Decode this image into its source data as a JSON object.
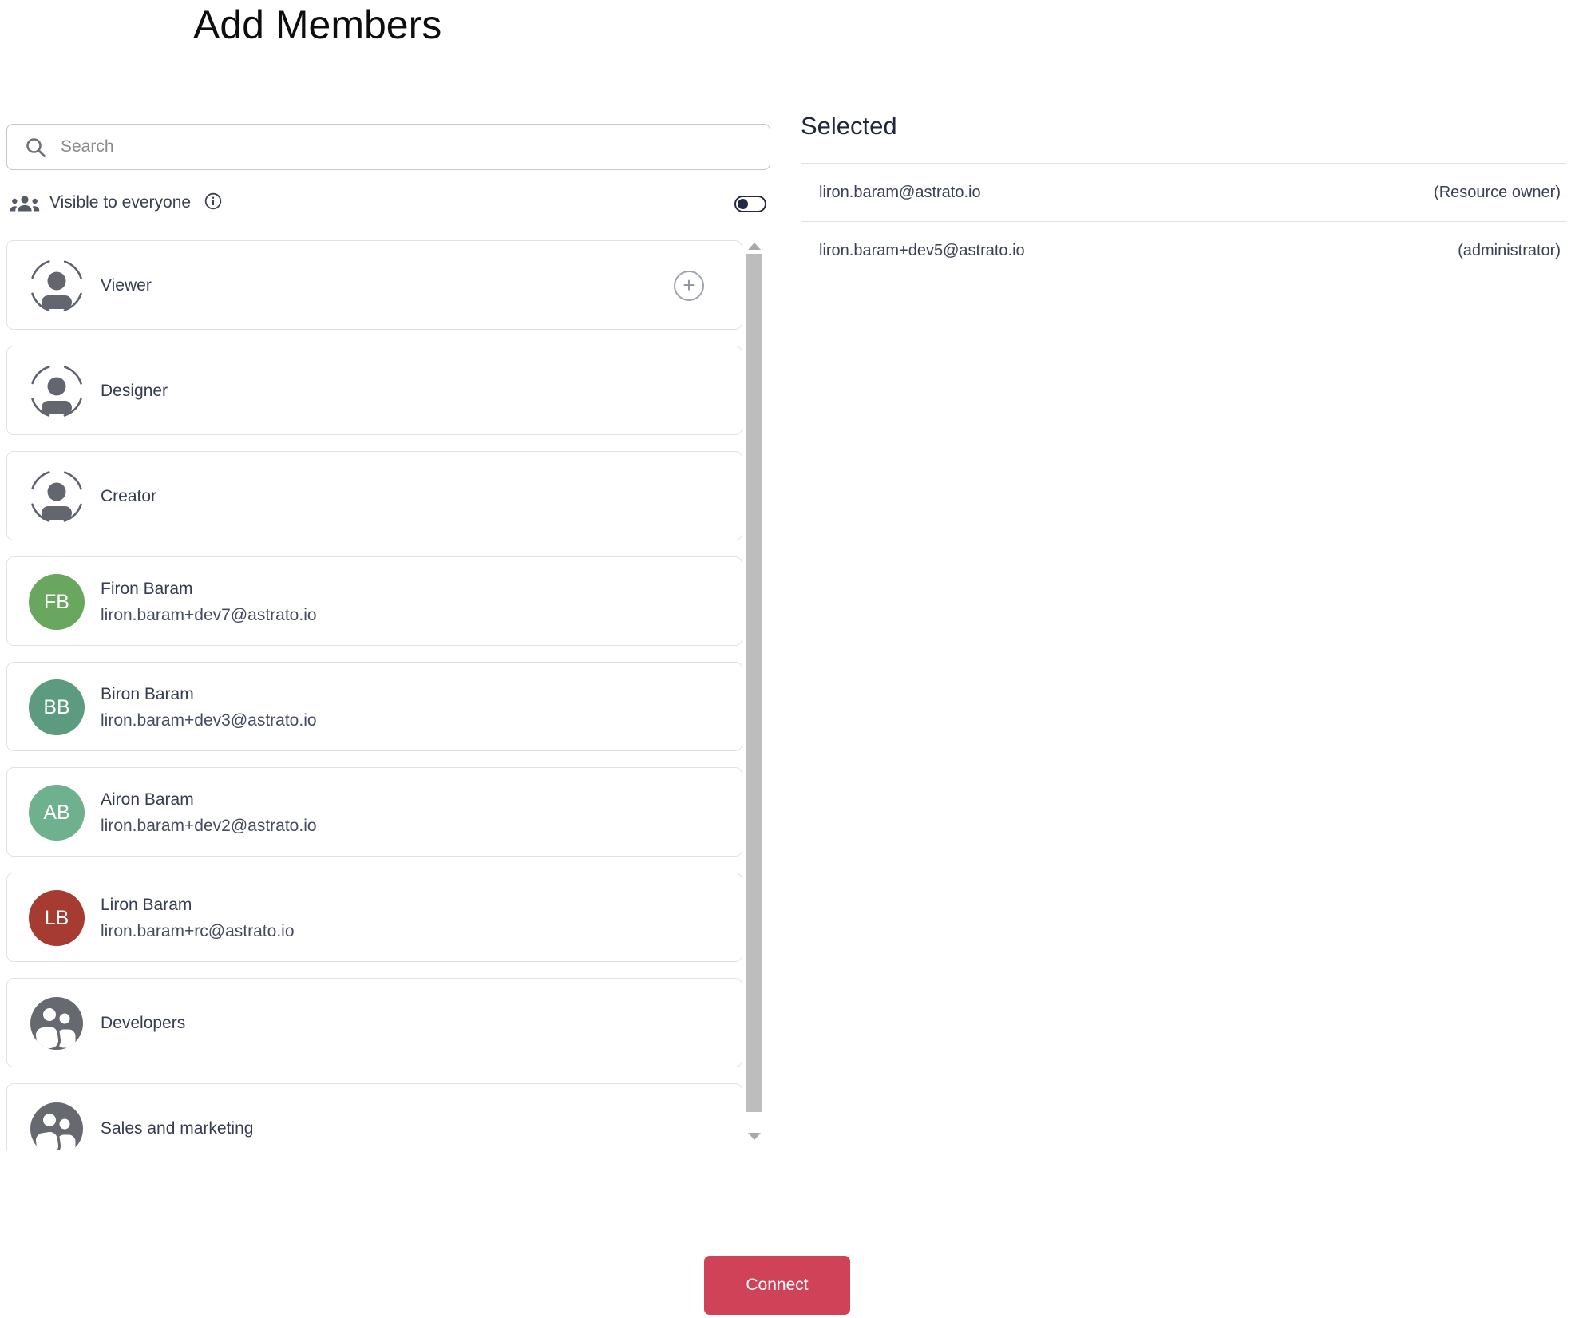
{
  "title": "Add Members",
  "search": {
    "placeholder": "Search"
  },
  "visibility": {
    "label": "Visible to everyone",
    "enabled": false
  },
  "member_list": {
    "items": [
      {
        "type": "role",
        "name": "Viewer",
        "show_add_button": true
      },
      {
        "type": "role",
        "name": "Designer",
        "show_add_button": false
      },
      {
        "type": "role",
        "name": "Creator",
        "show_add_button": false
      },
      {
        "type": "user",
        "initials": "FB",
        "name": "Firon Baram",
        "email": "liron.baram+dev7@astrato.io",
        "avatar_color": "#69a75e"
      },
      {
        "type": "user",
        "initials": "BB",
        "name": "Biron Baram",
        "email": "liron.baram+dev3@astrato.io",
        "avatar_color": "#5c9b80"
      },
      {
        "type": "user",
        "initials": "AB",
        "name": "Airon Baram",
        "email": "liron.baram+dev2@astrato.io",
        "avatar_color": "#6fb08f"
      },
      {
        "type": "user",
        "initials": "LB",
        "name": "Liron Baram",
        "email": "liron.baram+rc@astrato.io",
        "avatar_color": "#a63c31"
      },
      {
        "type": "group",
        "name": "Developers"
      },
      {
        "type": "group",
        "name": "Sales and marketing"
      }
    ]
  },
  "selected_panel": {
    "heading": "Selected",
    "members": [
      {
        "email": "liron.baram@astrato.io",
        "role": "(Resource owner)"
      },
      {
        "email": "liron.baram+dev5@astrato.io",
        "role": "(administrator)"
      }
    ]
  },
  "actions": {
    "connect_label": "Connect"
  },
  "colors": {
    "primary_button": "#cf4257",
    "toggle": "#262a41",
    "avatar_green": "#69a75e",
    "avatar_sea_green": "#5c9b80",
    "avatar_light_green": "#6fb08f",
    "avatar_red": "#a63c31",
    "icon_gray": "#63666f",
    "border": "#e2e2e2"
  }
}
